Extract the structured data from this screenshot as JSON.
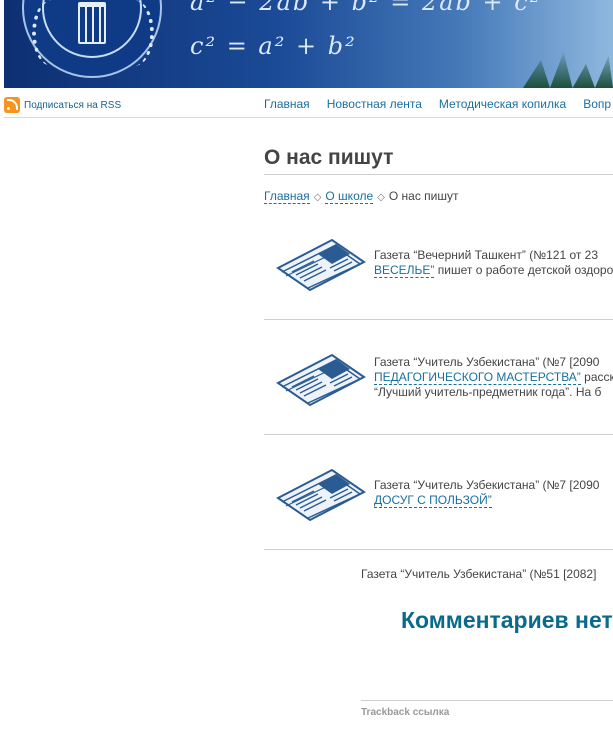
{
  "header": {
    "formula_line1": "a² − 2ab + b² = 2ab + c²",
    "formula_line2": "c² = a² + b²"
  },
  "rss": {
    "label": "Подписаться на RSS",
    "icon": "rss-icon"
  },
  "nav": {
    "items": [
      {
        "label": "Главная"
      },
      {
        "label": "Новостная лента"
      },
      {
        "label": "Методическая копилка"
      },
      {
        "label": "Вопр"
      }
    ]
  },
  "page": {
    "title": "О нас пишут",
    "breadcrumb": [
      {
        "label": "Главная",
        "link": true
      },
      {
        "label": "О школе",
        "link": true
      },
      {
        "label": "О нас пишут",
        "link": false
      }
    ],
    "breadcrumb_sep": "◇"
  },
  "articles": [
    {
      "icon": "newspaper-icon",
      "line1": "Газета “Вечерний Ташкент” (№121 от 23",
      "link": "ВЕСЕЛЬЕ”",
      "after": " пишет о работе детской оздоро"
    },
    {
      "icon": "newspaper-icon",
      "line1": "Газета “Учитель Узбекистана” (№7 [2090",
      "link": "ПЕДАГОГИЧЕСКОГО МАСТЕРСТВА”",
      "after": " расска",
      "line3": "“Лучший учитель-предметник года”. На б"
    },
    {
      "icon": "newspaper-icon",
      "line1": "Газета “Учитель Узбекистана” (№7 [2090",
      "link": "ДОСУГ С ПОЛЬЗОЙ”",
      "after": ""
    }
  ],
  "last_article": "Газета “Учитель Узбекистана” (№51 [2082]",
  "comments_heading": "Комментариев нет",
  "trackback_label": "Trackback ссылка"
}
